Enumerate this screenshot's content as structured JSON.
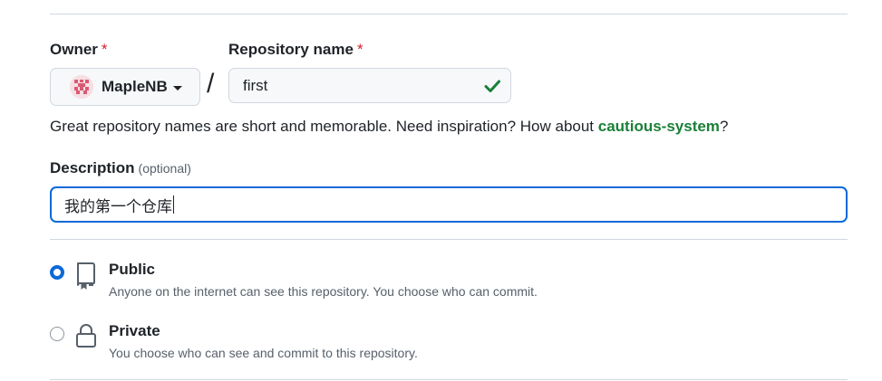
{
  "owner": {
    "label": "Owner",
    "required_mark": "*",
    "value": "MapleNB",
    "avatar_icon": "identicon-avatar"
  },
  "repository_name": {
    "label": "Repository name",
    "required_mark": "*",
    "value": "first",
    "separator": "/",
    "status_icon": "check-icon",
    "status_color": "#1a7f37"
  },
  "hint": {
    "prefix": "Great repository names are short and memorable. Need inspiration? How about ",
    "suggestion": "cautious-system",
    "suffix": "?"
  },
  "description": {
    "label": "Description",
    "optional_text": "(optional)",
    "value": "我的第一个仓库"
  },
  "visibility": {
    "options": [
      {
        "title": "Public",
        "description": "Anyone on the internet can see this repository. You choose who can commit.",
        "icon": "repo-icon",
        "selected": true
      },
      {
        "title": "Private",
        "description": "You choose who can see and commit to this repository.",
        "icon": "lock-icon",
        "selected": false
      }
    ]
  },
  "colors": {
    "accent": "#0969da",
    "success": "#1a7f37",
    "danger": "#cf222e",
    "border": "#d0d7de"
  }
}
